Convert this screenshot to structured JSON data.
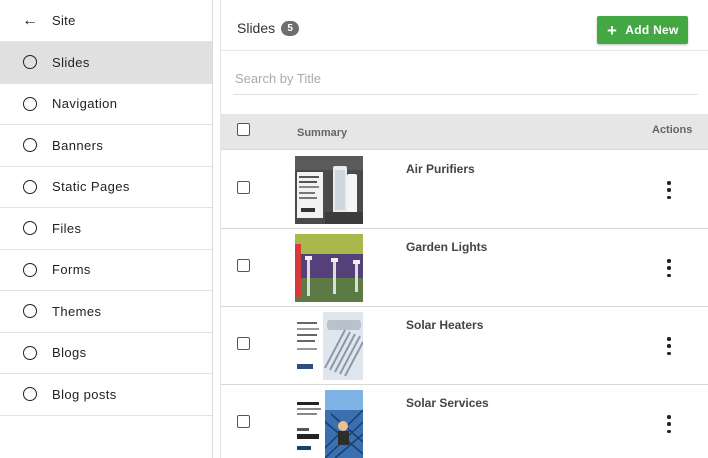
{
  "sidebar": {
    "back": {
      "icon": "arrow-left-icon",
      "label": "Site"
    },
    "active_index": 0,
    "items": [
      {
        "label": "Slides"
      },
      {
        "label": "Navigation"
      },
      {
        "label": "Banners"
      },
      {
        "label": "Static Pages"
      },
      {
        "label": "Files"
      },
      {
        "label": "Forms"
      },
      {
        "label": "Themes"
      },
      {
        "label": "Blogs"
      },
      {
        "label": "Blog posts"
      }
    ]
  },
  "header": {
    "title": "Slides",
    "count": "5",
    "add_button": {
      "icon": "plus-icon",
      "label": "Add New",
      "color": "#43a843"
    }
  },
  "search": {
    "placeholder": "Search by Title",
    "value": ""
  },
  "table": {
    "columns": {
      "summary": "Summary",
      "actions": "Actions"
    },
    "rows": [
      {
        "title": "Air Purifiers",
        "thumb": "air-purifier-thumbnail"
      },
      {
        "title": "Garden Lights",
        "thumb": "garden-lights-thumbnail"
      },
      {
        "title": "Solar Heaters",
        "thumb": "solar-heaters-thumbnail"
      },
      {
        "title": "Solar Services",
        "thumb": "solar-services-thumbnail"
      }
    ]
  }
}
